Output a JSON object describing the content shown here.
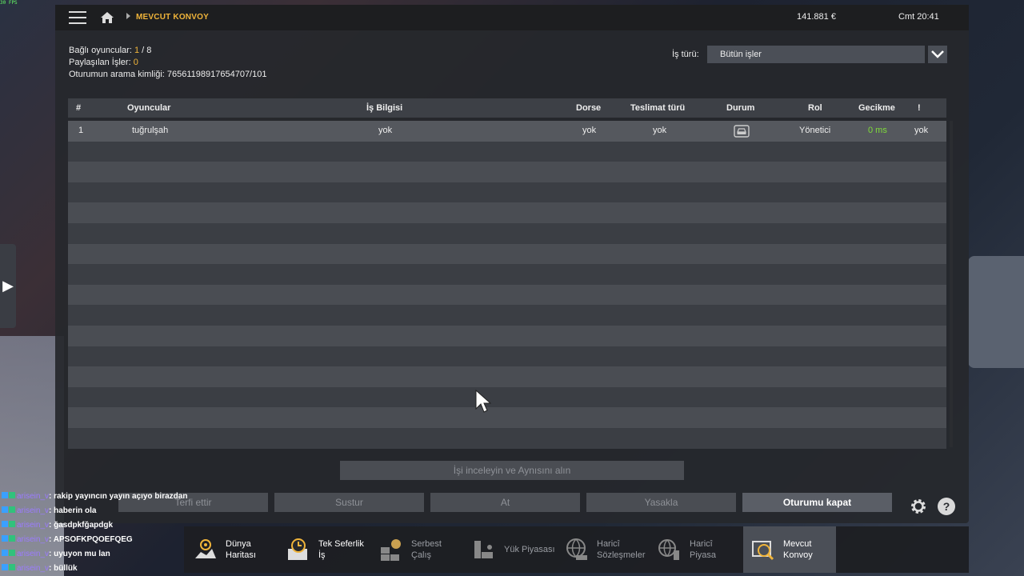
{
  "overlay": {
    "fps": "30 FPS"
  },
  "topbar": {
    "breadcrumb": "MEVCUT KONVOY",
    "money": "141.881 €",
    "clock": "Cmt 20:41"
  },
  "info": {
    "players_label": "Bağlı oyuncular: ",
    "players_current": "1",
    "players_sep": " / ",
    "players_max": "8",
    "jobs_label": "Paylaşılan İşler: ",
    "jobs_value": "0",
    "session_label": "Oturumun arama kimliği: ",
    "session_id": "76561198917654707/101"
  },
  "filter": {
    "label": "İş türü:",
    "value": "Bütün işler"
  },
  "table": {
    "headers": {
      "num": "#",
      "players": "Oyuncular",
      "job": "İş Bilgisi",
      "trailer": "Dorse",
      "delivery": "Teslimat türü",
      "status": "Durum",
      "role": "Rol",
      "latency": "Gecikme",
      "warn": "!"
    },
    "rows": [
      {
        "num": "1",
        "player": "tuğrulşah",
        "job": "yok",
        "trailer": "yok",
        "delivery": "yok",
        "status_icon": "car-icon",
        "role": "Yönetici",
        "latency": "0 ms",
        "warn": "yok"
      }
    ]
  },
  "buttons": {
    "inspect": "İşi inceleyin ve Aynısını alın",
    "promote": "Terfi ettir",
    "mute": "Sustur",
    "kick": "At",
    "ban": "Yasakla",
    "close_session": "Oturumu kapat",
    "help": "?"
  },
  "chat": [
    {
      "name": "arisein_v",
      "text": ": rakip yayıncın yayın açıyo birazdan"
    },
    {
      "name": "arisein_v",
      "text": ": haberin ola"
    },
    {
      "name": "arisein_v",
      "text": ": ğasdpkfğapdgk"
    },
    {
      "name": "arisein_v",
      "text": ": APSOFKPQOEFQEG"
    },
    {
      "name": "arisein_v",
      "text": ": uyuyon mu lan"
    },
    {
      "name": "arisein_v",
      "text": ": büllük"
    }
  ],
  "dock": [
    {
      "label": "Dünya\nHaritası",
      "icon": "world-map-icon"
    },
    {
      "label": "Tek Seferlik\nİş",
      "icon": "clock-job-icon"
    },
    {
      "label": "Serbest\nÇalış",
      "icon": "freelance-icon"
    },
    {
      "label": "Yük Piyasası",
      "icon": "cargo-market-icon"
    },
    {
      "label": "Haricî\nSözleşmeler",
      "icon": "contracts-globe-icon"
    },
    {
      "label": "Haricî\nPiyasa",
      "icon": "market-globe-icon"
    },
    {
      "label": "Mevcut\nKonvoy",
      "icon": "convoy-icon"
    }
  ],
  "colors": {
    "accent": "#f0b43a",
    "latency_ok": "#7fdc3a"
  }
}
